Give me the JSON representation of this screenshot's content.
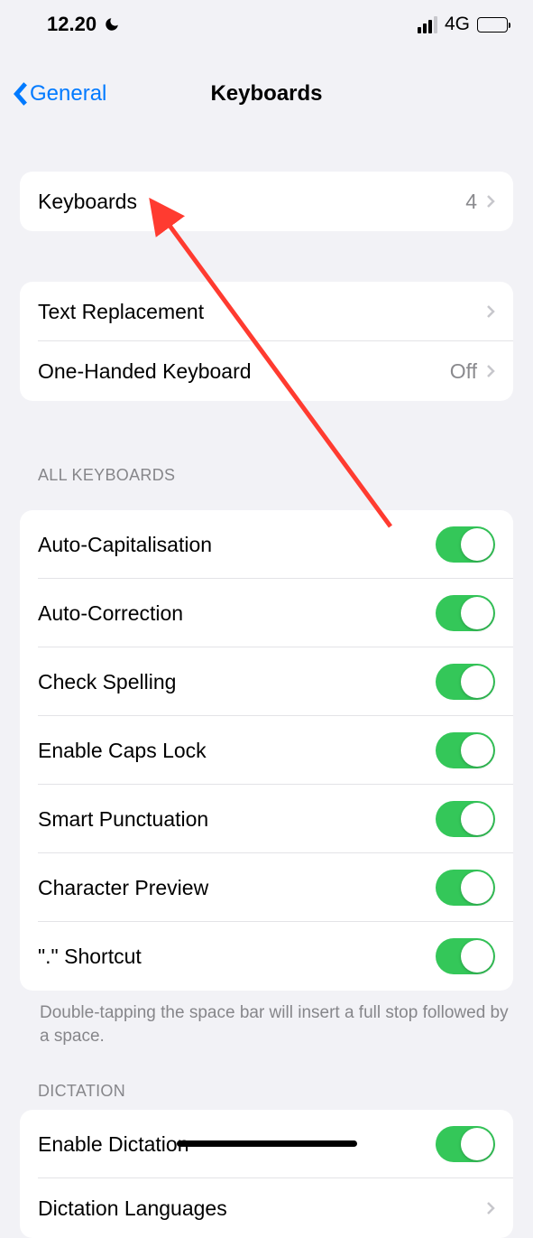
{
  "status": {
    "time": "12.20",
    "network": "4G"
  },
  "nav": {
    "back_label": "General",
    "title": "Keyboards"
  },
  "group1": {
    "keyboards": {
      "label": "Keyboards",
      "value": "4"
    }
  },
  "group2": {
    "text_replacement": {
      "label": "Text Replacement"
    },
    "one_handed": {
      "label": "One-Handed Keyboard",
      "value": "Off"
    }
  },
  "headers": {
    "all_keyboards": "ALL KEYBOARDS",
    "dictation": "DICTATION"
  },
  "all_keyboards": {
    "auto_capitalisation": "Auto-Capitalisation",
    "auto_correction": "Auto-Correction",
    "check_spelling": "Check Spelling",
    "enable_caps_lock": "Enable Caps Lock",
    "smart_punctuation": "Smart Punctuation",
    "character_preview": "Character Preview",
    "dot_shortcut": "\".\" Shortcut"
  },
  "footer": {
    "dot_shortcut_note": "Double-tapping the space bar will insert a full stop followed by a space."
  },
  "dictation": {
    "enable": "Enable Dictation",
    "languages": "Dictation Languages"
  }
}
